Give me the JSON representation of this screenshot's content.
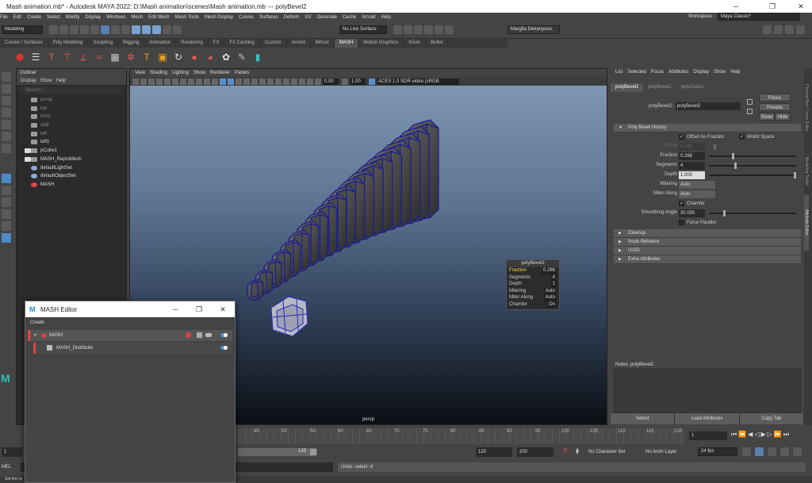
{
  "window": {
    "title": "Mash animation.mb* - Autodesk MAYA 2022: D:\\Mash animation\\scenes\\Mash animation.mb  ---  polyBevel2",
    "minimize": "─",
    "maximize": "❐",
    "close": "✕"
  },
  "menu": [
    "File",
    "Edit",
    "Create",
    "Select",
    "Modify",
    "Display",
    "Windows",
    "Mesh",
    "Edit Mesh",
    "Mesh Tools",
    "Mesh Display",
    "Curves",
    "Surfaces",
    "Deform",
    "UV",
    "Generate",
    "Cache",
    "Arnold",
    "Help"
  ],
  "workspace": {
    "label": "Workspace :",
    "value": "Maya Classic*"
  },
  "status": {
    "mode": "Modeling",
    "live_surface": "No Live Surface",
    "user": "Margita Dekanyova"
  },
  "shelf_tabs": [
    "Curves / Surfaces",
    "Poly Modeling",
    "Sculpting",
    "Rigging",
    "Animation",
    "Rendering",
    "FX",
    "FX Caching",
    "Custom",
    "Arnold",
    "Bifrost",
    "MASH",
    "Motion Graphics",
    "XGen",
    "Bullet"
  ],
  "shelf_active": "MASH",
  "outliner": {
    "title": "Outliner",
    "menu": [
      "Display",
      "Show",
      "Help"
    ],
    "search_placeholder": "Search...",
    "items": [
      {
        "label": "persp",
        "dim": true
      },
      {
        "label": "top",
        "dim": true
      },
      {
        "label": "front",
        "dim": true
      },
      {
        "label": "side",
        "dim": true
      },
      {
        "label": "left",
        "dim": true
      },
      {
        "label": "left1",
        "dim": false
      },
      {
        "label": "pCube1",
        "dim": false
      },
      {
        "label": "MASH_ReproMesh",
        "dim": false
      },
      {
        "label": "defaultLightSet",
        "dim": false
      },
      {
        "label": "defaultObjectSet",
        "dim": false
      },
      {
        "label": "MASH",
        "dim": false
      }
    ]
  },
  "viewport": {
    "menu": [
      "View",
      "Shading",
      "Lighting",
      "Show",
      "Renderer",
      "Panels"
    ],
    "exposure": "0.00",
    "gamma": "1.00",
    "color_space": "ACES 1.0 SDR-video (sRGB",
    "camera": "persp"
  },
  "hud": {
    "title": "polyBevel2",
    "rows": [
      {
        "k": "Fraction",
        "v": "0.268",
        "hl": true
      },
      {
        "k": "Segments",
        "v": "4",
        "hl": false
      },
      {
        "k": "Depth",
        "v": "1",
        "hl": false
      },
      {
        "k": "Mitering",
        "v": "Auto",
        "hl": false
      },
      {
        "k": "Miter Along",
        "v": "Auto",
        "hl": false
      },
      {
        "k": "Chamfer",
        "v": "On",
        "hl": false
      }
    ]
  },
  "attr": {
    "menu": [
      "List",
      "Selected",
      "Focus",
      "Attributes",
      "Display",
      "Show",
      "Help"
    ],
    "tabs": [
      "polyBevel2",
      "polyBevel1",
      "polyCube1"
    ],
    "node_label": "polyBevel2:",
    "node_value": "polyBevel2",
    "focus": "Focus",
    "presets": "Presets",
    "show": "Show",
    "hide": "Hide",
    "history_title": "Poly Bevel History",
    "offset_as_fraction": "Offset As Fraction",
    "world_space": "World Space",
    "offset_label": "Offset",
    "offset_value": "0.200",
    "fraction_label": "Fraction",
    "fraction_value": "0.268",
    "fraction_level": 0.268,
    "segments_label": "Segments",
    "segments_value": "4",
    "segments_level": 0.3,
    "depth_label": "Depth",
    "depth_value": "1.000",
    "depth_level": 1.0,
    "mitering_label": "Mitering",
    "mitering_value": "Auto",
    "miter_along_label": "Miter Along",
    "miter_along_value": "Auto",
    "chamfer": "Chamfer",
    "smoothing_label": "Smoothing Angle",
    "smoothing_value": "30.000",
    "smoothing_level": 0.17,
    "force_parallel": "Force Parallel",
    "sections": [
      "Cleanup",
      "Node Behavior",
      "UUID",
      "Extra Attributes"
    ],
    "notes": "Notes:  polyBevel2",
    "btn_select": "Select",
    "btn_load": "Load Attributes",
    "btn_copy": "Copy Tab"
  },
  "side_tabs": [
    "Channel Box / Layer Editor",
    "Modeling Toolkit",
    "Attribute Editor"
  ],
  "timeline": {
    "ticks": [
      "45",
      "50",
      "55",
      "60",
      "65",
      "70",
      "75",
      "80",
      "85",
      "90",
      "95",
      "100",
      "105",
      "110",
      "115",
      "120"
    ],
    "current": "1",
    "start_frame": "1",
    "range_end": "120",
    "end_a": "120",
    "end_b": "200",
    "character_set": "No Character Set",
    "anim_layer": "No Anim Layer",
    "fps": "24 fps"
  },
  "cmd": {
    "lang": "MEL",
    "result": "Undo: select -d"
  },
  "helpline": "Set the ra",
  "mash_editor": {
    "title": "MASH Editor",
    "create": "Create",
    "logo": "M",
    "rows": [
      "MASH",
      "MASH_Distribute"
    ]
  }
}
